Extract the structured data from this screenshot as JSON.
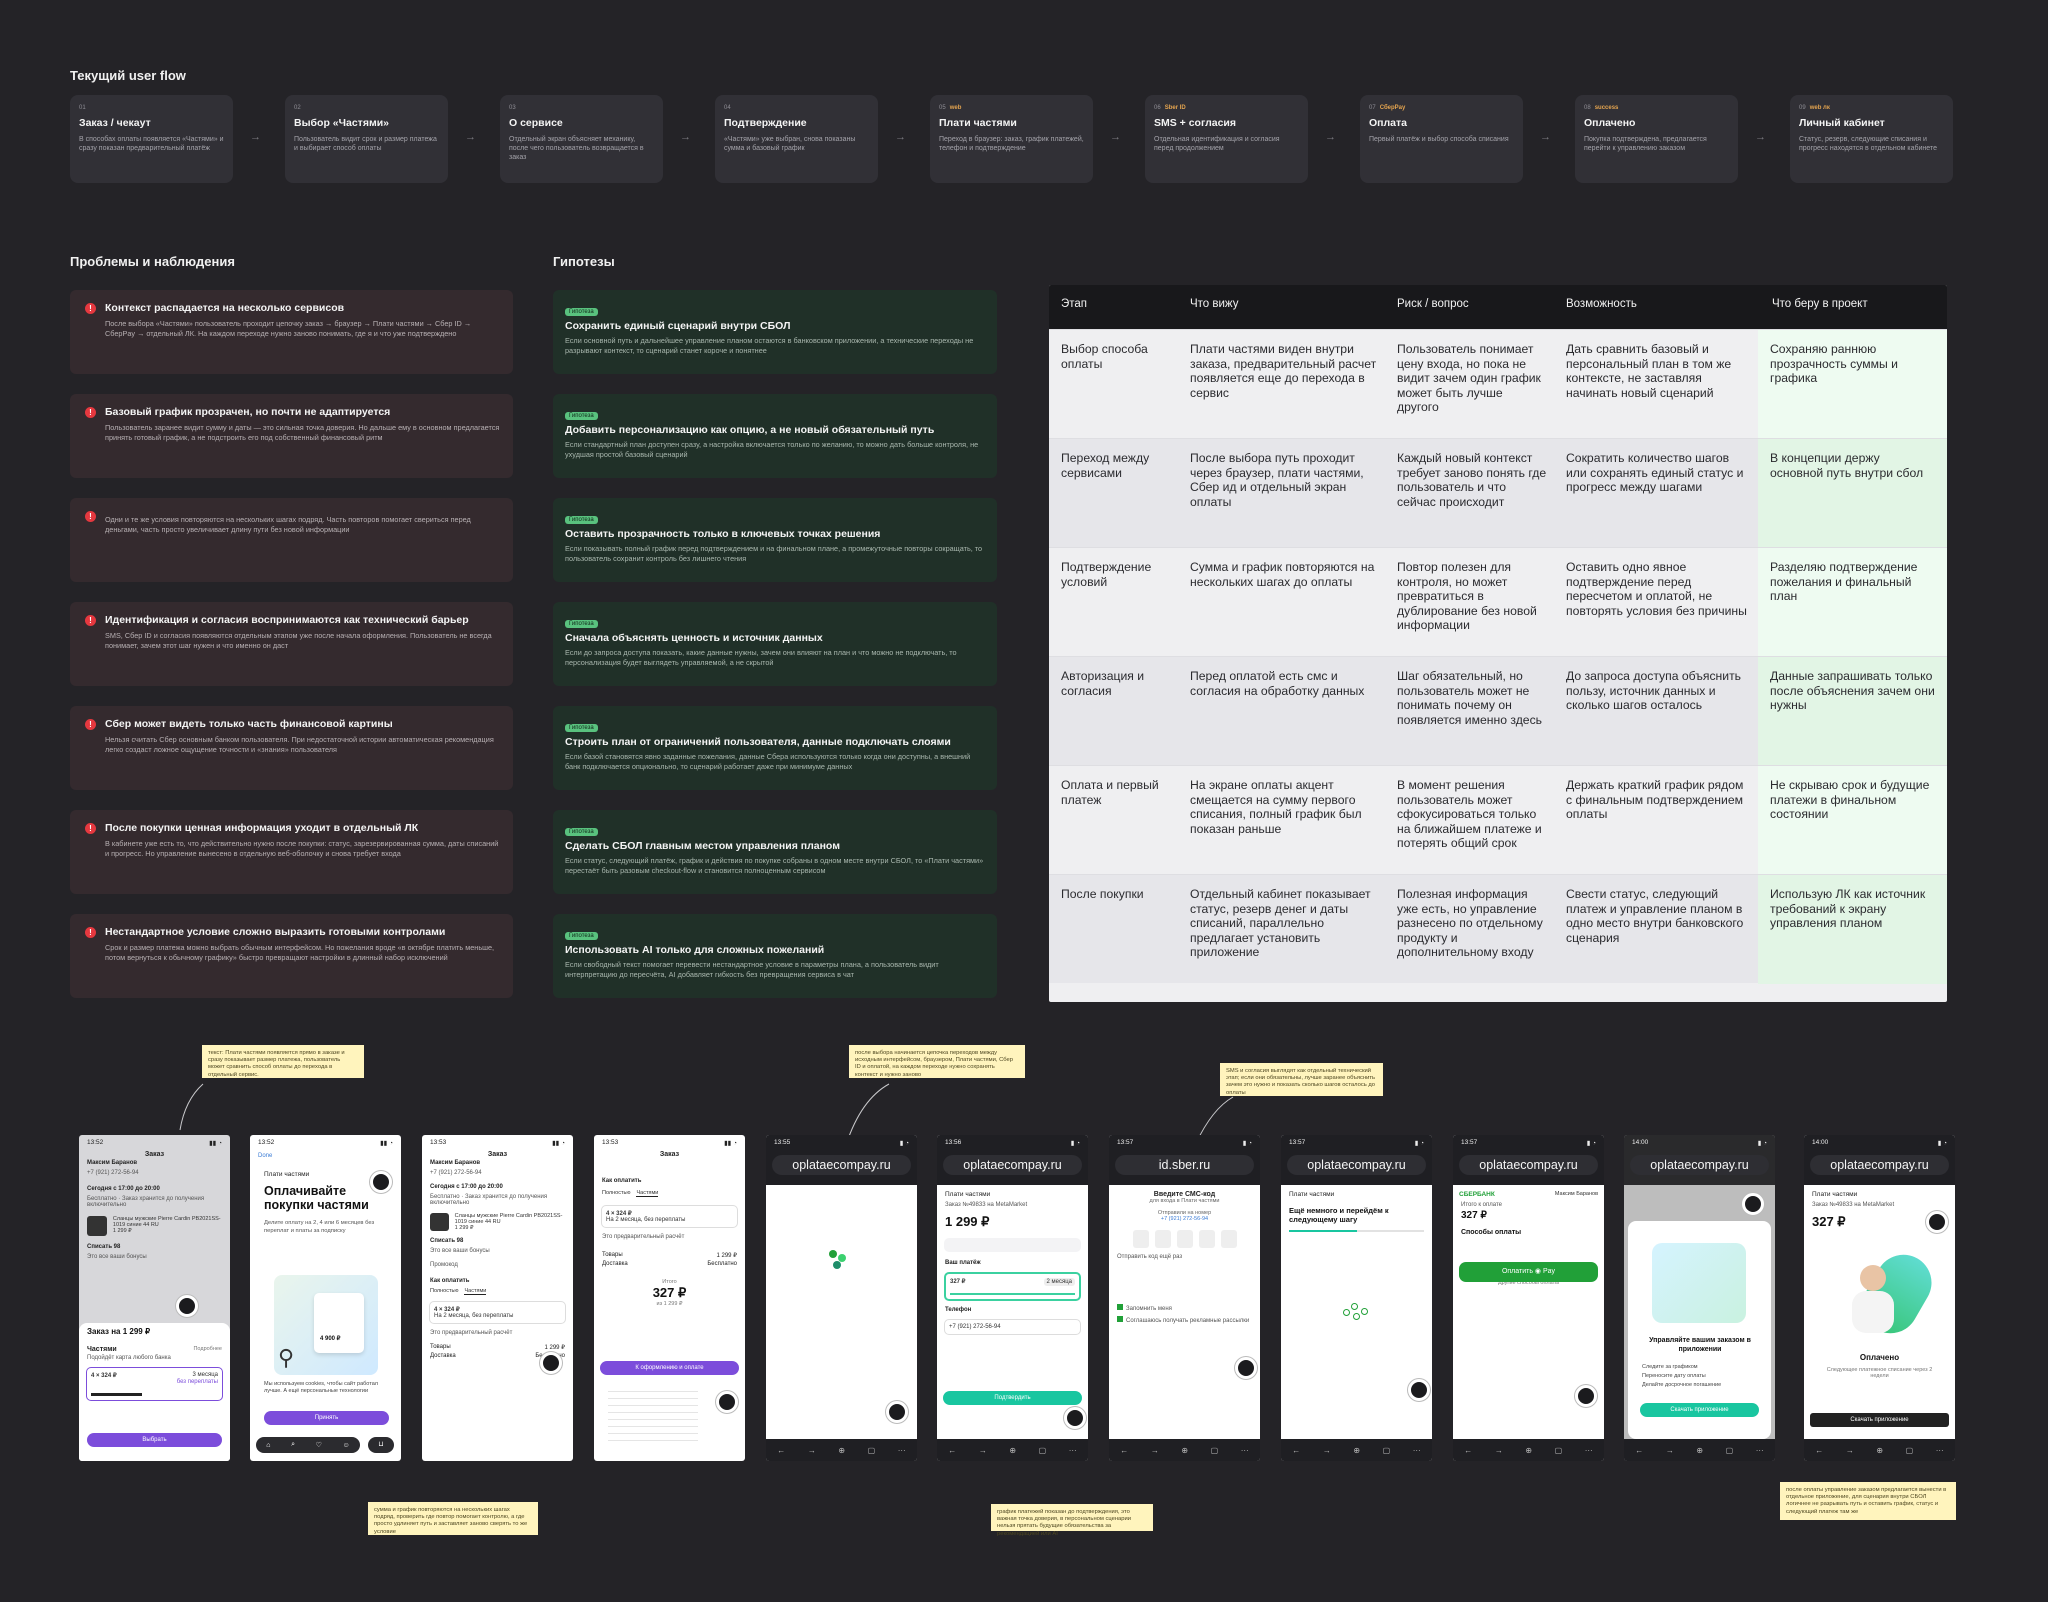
{
  "flow": {
    "title": "Текущий user flow",
    "steps": [
      {
        "num": "01",
        "tag": "",
        "title": "Заказ / чекаут",
        "desc": "В способах оплаты появляется «Частями» и сразу показан предварительный платёж"
      },
      {
        "num": "02",
        "tag": "",
        "title": "Выбор «Частями»",
        "desc": "Пользователь видит срок и размер платежа и выбирает способ оплаты"
      },
      {
        "num": "03",
        "tag": "",
        "title": "О сервисе",
        "desc": "Отдельный экран объясняет механику, после чего пользователь возвращается в заказ"
      },
      {
        "num": "04",
        "tag": "",
        "title": "Подтверждение",
        "desc": "«Частями» уже выбран, снова показаны сумма и базовый график"
      },
      {
        "num": "05",
        "tag": "web",
        "title": "Плати частями",
        "desc": "Переход в браузер: заказ, график платежей, телефон и подтверждение"
      },
      {
        "num": "06",
        "tag": "Sber ID",
        "title": "SMS + согласия",
        "desc": "Отдельная идентификация и согласия перед продолжением"
      },
      {
        "num": "07",
        "tag": "СберPay",
        "title": "Оплата",
        "desc": "Первый платёж и выбор способа списания"
      },
      {
        "num": "08",
        "tag": "success",
        "title": "Оплачено",
        "desc": "Покупка подтверждена, предлагается перейти к управлению заказом"
      },
      {
        "num": "09",
        "tag": "web лк",
        "title": "Личный кабинет",
        "desc": "Статус, резерв, следующие списания и прогресс находятся в отдельном кабинете"
      }
    ]
  },
  "problems": {
    "title": "Проблемы и наблюдения",
    "items": [
      {
        "title": "Контекст распадается на несколько сервисов",
        "desc": "После выбора «Частями» пользователь проходит цепочку заказ → браузер → Плати частями → Сбер ID → СберPay → отдельный ЛК. На каждом переходе нужно заново понимать, где я и что уже подтверждено"
      },
      {
        "title": "Базовый график прозрачен, но почти не адаптируется",
        "desc": "Пользователь заранее видит сумму и даты — это сильная точка доверия. Но дальше ему в основном предлагается принять готовый график, а не подстроить его под собственный финансовый ритм"
      },
      {
        "title": "",
        "desc": "Одни и те же условия повторяются на нескольких шагах подряд. Часть повторов помогает свериться перед деньгами, часть просто увеличивает длину пути без новой информации"
      },
      {
        "title": "Идентификация и согласия воспринимаются как технический барьер",
        "desc": "SMS, Сбер ID и согласия появляются отдельным этапом уже после начала оформления. Пользователь не всегда понимает, зачем этот шаг нужен и что именно он даст"
      },
      {
        "title": "Сбер может видеть только часть финансовой картины",
        "desc": "Нельзя считать Сбер основным банком пользователя. При недостаточной истории автоматическая рекомендация легко создаст ложное ощущение точности и «знания» пользователя"
      },
      {
        "title": "После покупки ценная информация уходит в отдельный ЛК",
        "desc": "В кабинете уже есть то, что действительно нужно после покупки: статус, зарезервированная сумма, даты списаний и прогресс. Но управление вынесено в отдельную веб-оболочку и снова требует входа"
      },
      {
        "title": "Нестандартное условие сложно выразить готовыми контролами",
        "desc": "Срок и размер платежа можно выбрать обычным интерфейсом. Но пожелания вроде «в октябре платить меньше, потом вернуться к обычному графику» быстро превращают настройки в длинный набор исключений"
      }
    ]
  },
  "hypotheses": {
    "title": "Гипотезы",
    "tag": "Гипотеза",
    "items": [
      {
        "title": "Сохранить единый сценарий внутри СБОЛ",
        "desc": "Если основной путь и дальнейшее управление планом остаются в банковском приложении, а технические переходы не разрывают контекст, то сценарий станет короче и понятнее"
      },
      {
        "title": "Добавить персонализацию как опцию, а не новый обязательный путь",
        "desc": "Если стандартный план доступен сразу, а настройка включается только по желанию, то можно дать больше контроля, не ухудшая простой базовый сценарий"
      },
      {
        "title": "Оставить прозрачность только в ключевых точках решения",
        "desc": "Если показывать полный график перед подтверждением и на финальном плане, а промежуточные повторы сокращать, то пользователь сохранит контроль без лишнего чтения"
      },
      {
        "title": "Сначала объяснять ценность и источник данных",
        "desc": "Если до запроса доступа показать, какие данные нужны, зачем они влияют на план и что можно не подключать, то персонализация будет выглядеть управляемой, а не скрытой"
      },
      {
        "title": "Строить план от ограничений пользователя, данные подключать слоями",
        "desc": "Если базой становятся явно заданные пожелания, данные Сбера используются только когда они доступны, а внешний банк подключается опционально, то сценарий работает даже при минимуме данных"
      },
      {
        "title": "Сделать СБОЛ главным местом управления планом",
        "desc": "Если статус, следующий платёж, график и действия по покупке собраны в одном месте внутри СБОЛ, то «Плати частями» перестаёт быть разовым checkout-flow и становится полноценным сервисом"
      },
      {
        "title": "Использовать AI только для сложных пожеланий",
        "desc": "Если свободный текст помогает перевести нестандартное условие в параметры плана, а пользователь видит интерпретацию до пересчёта, AI добавляет гибкость без превращения сервиса в чат"
      }
    ]
  },
  "table": {
    "headers": [
      "Этап",
      "Что вижу",
      "Риск / вопрос",
      "Возможность",
      "Что беру в проект"
    ],
    "rows": [
      [
        "Выбор способа оплаты",
        "Плати частями виден внутри заказа, предварительный расчет появляется еще до перехода в сервис",
        "Пользователь понимает цену входа, но пока не видит зачем один график может быть лучше другого",
        "Дать сравнить базовый и персональный план в том же контексте, не заставляя начинать новый сценарий",
        "Сохраняю раннюю прозрачность суммы и графика"
      ],
      [
        "Переход между сервисами",
        "После выбора путь проходит через браузер, плати частями, Сбер ид и отдельный экран оплаты",
        "Каждый новый контекст требует заново понять где пользователь и что сейчас происходит",
        "Сократить количество шагов или сохранять единый статус и прогресс между шагами",
        "В концепции держу основной путь внутри сбол"
      ],
      [
        "Подтверждение условий",
        "Сумма и график повторяются на нескольких шагах до оплаты",
        "Повтор полезен для контроля, но может превратиться в дублирование без новой информации",
        "Оставить одно явное подтверждение перед пересчетом и оплатой, не повторять условия без причины",
        "Разделяю подтверждение пожелания и финальный план"
      ],
      [
        "Авторизация и согласия",
        "Перед оплатой есть смс и согласия на обработку данных",
        "Шаг обязательный, но пользователь может не понимать почему он появляется именно здесь",
        "До запроса доступа объяснить пользу, источник данных и сколько шагов осталось",
        "Данные запрашивать только после объяснения зачем они нужны"
      ],
      [
        "Оплата и первый платеж",
        "На экране оплаты акцент смещается на сумму первого списания, полный график был показан раньше",
        "В момент решения пользователь может сфокусироваться только на ближайшем платеже и потерять общий срок",
        "Держать краткий график рядом с финальным подтверждением оплаты",
        "Не скрываю срок и будущие платежи в финальном состоянии"
      ],
      [
        "После покупки",
        "Отдельный кабинет показывает статус, резерв денег и даты списаний, параллельно предлагает установить приложение",
        "Полезная информация уже есть, но управление разнесено по отдельному продукту и дополнительному входу",
        "Свести статус, следующий платеж и управление планом в одно место внутри банковского сценария",
        "Использую ЛК как источник требований к экрану управления планом"
      ]
    ]
  },
  "notes": [
    "текст: Плати частями появляется прямо в заказе и сразу показывает размер платежа, пользователь может сравнить способ оплаты до перехода в отдельный сервис.",
    "после выбора начинается цепочка переходов между исходным интерфейсом, браузером, Плати частями, Сбер ID и оплатой, на каждом переходе нужно сохранять контекст и нужно заново",
    "SMS и согласия выглядят как отдельный технический этап; если они обязательны, лучше заранее объяснить зачем это нужно и показать сколько шагов осталось до оплаты",
    "сумма и график повторяются на нескольких шагах подряд, проверить где повтор помогает контролю, а где просто удлиняет путь и заставляет заново сверять то же условие",
    "график платежей показан до подтверждения, это важная точка доверия, в персональном сценарии нельзя прятать будущие обязательства за рекомендацией или AI",
    "после оплаты управление заказом предлагается вынести в отдельное приложение, для сценария внутри СБОЛ логичнее не разрывать путь и оставить график, статус и следующий платеж там же"
  ],
  "phones": {
    "p1": {
      "time": "13:52",
      "header": "Заказ",
      "name": "Максим Баранов",
      "phone": "+7 (921) 272-56-94",
      "date": "Сегодня с 17:00 до 20:00",
      "delivery": "Бесплатно · Заказ хранится до получения включительно",
      "product": "Сланцы мужские Pierre Cardin PB2021SS-1019 синие 44 RU",
      "price": "1 299 ₽",
      "bonus": "Списать 98",
      "bonus_sub": "Это все ваши бонусы",
      "sheet_title": "Заказ на 1 299 ₽",
      "parts": "Частями",
      "parts_more": "Подробнее",
      "parts_sub": "Подойдёт карта любого банка",
      "amount": "4 × 324 ₽",
      "months": "3 месяца",
      "overpay": "без переплаты",
      "button": "Выбрать"
    },
    "p2": {
      "time": "13:52",
      "done": "Done",
      "brand": "Плати частями",
      "title": "Оплачивайте покупки частями",
      "desc": "Делите оплату на 2, 4 или 6 месяцев без переплат и платы за подписку",
      "price_tag": "4 900 ₽",
      "cookie": "Мы используем cookies, чтобы сайт работал лучше. А ещё персональные технологии",
      "button": "Принять"
    },
    "p3": {
      "time": "13:53",
      "header": "Заказ",
      "name": "Максим Баранов",
      "phone": "+7 (921) 272-56-94",
      "date": "Сегодня с 17:00 до 20:00",
      "delivery": "Бесплатно · Заказ хранится до получения включительно",
      "product": "Сланцы мужские Pierre Cardin PB2021SS-1019 синие 44 RU",
      "price": "1 299 ₽",
      "bonus": "Списать 98",
      "bonus_sub": "Это все ваши бонусы",
      "promo": "Промокод",
      "how": "Как оплатить",
      "opt1": "Полностью",
      "opt2": "Частями",
      "amount": "4 × 324 ₽",
      "amount_sub": "На 2 месяца, без переплаты",
      "calc": "Это предварительный расчёт",
      "goods": "Товары",
      "goods_val": "1 299 ₽",
      "delivery_l": "Доставка",
      "delivery_v": "Бесплатно"
    },
    "p4": {
      "time": "13:53",
      "header": "Заказ",
      "how": "Как оплатить",
      "opt1": "Полностью",
      "opt2": "Частями",
      "amount": "4 × 324 ₽",
      "amount_sub": "На 2 месяца, без переплаты",
      "calc": "Это предварительный расчёт",
      "goods": "Товары",
      "goods_val": "1 299 ₽",
      "delivery_l": "Доставка",
      "delivery_v": "Бесплатно",
      "total_l": "Итого",
      "total": "327 ₽",
      "total_sub": "из 1 299 ₽",
      "button": "К оформлению и оплате"
    },
    "p5": {
      "time": "13:55",
      "url": "oplataecompay.ru"
    },
    "p6": {
      "time": "13:56",
      "url": "oplataecompay.ru",
      "brand": "Плати частями",
      "order": "Заказ №49833 на MetaMarket",
      "sum": "1 299 ₽",
      "pay": "Ваш платёж",
      "amount": "327 ₽",
      "months": "2 месяца",
      "phone_l": "Телефон",
      "phone": "+7 (921) 272-56-94",
      "button": "Подтвердить"
    },
    "p7": {
      "time": "13:57",
      "url": "id.sber.ru",
      "title": "Введите СМС-код",
      "sub": "для входа в Плати частями",
      "sent": "Отправили на номер",
      "phone": "+7 (921) 272-56-94",
      "resend": "Отправить код ещё раз",
      "cons1": "Запомнить меня",
      "cons2": "Соглашаюсь получать рекламные рассылки"
    },
    "p8": {
      "time": "13:57",
      "url": "oplataecompay.ru",
      "brand": "Плати частями",
      "title": "Ещё немного и перейдём к следующему шагу"
    },
    "p9": {
      "time": "13:57",
      "url": "oplataecompay.ru",
      "bank": "СБЕРБАНК",
      "user": "Максим Баранов",
      "pay_l": "Итого к оплате",
      "sum": "327 ₽",
      "methods": "Способы оплаты",
      "button": "Оплатить",
      "pay": "Pay",
      "other": "Другие способы оплаты"
    },
    "p10": {
      "time": "14:00",
      "url": "oplataecompay.ru",
      "title": "Управляйте вашим заказом в приложении",
      "f1": "Следите за графиком",
      "f2": "Переносите дату оплаты",
      "f3": "Делайте досрочное погашение",
      "button": "Скачать приложение"
    },
    "p11": {
      "time": "14:00",
      "url": "oplataecompay.ru",
      "brand": "Плати частями",
      "order": "Заказ №49833 на MetaMarket",
      "sum": "327 ₽",
      "status": "Оплачено",
      "status_sub": "Следующее платежное списание через 2 недели",
      "button": "Скачать приложение"
    }
  },
  "colors": {
    "bg": "#242327",
    "problem": "#342a2e",
    "hypothesis": "#203028",
    "accent_red": "#e5383f",
    "accent_green": "#59c27e",
    "sber_green": "#21a038",
    "purple": "#7c4ddb"
  }
}
